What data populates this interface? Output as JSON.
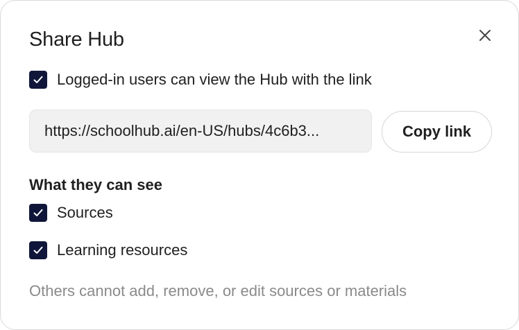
{
  "dialog": {
    "title": "Share Hub",
    "close_icon": "close-icon"
  },
  "access": {
    "logged_in_label": "Logged-in users can view the Hub with the link",
    "logged_in_checked": true
  },
  "link": {
    "value": "https://schoolhub.ai/en-US/hubs/4c6b3...",
    "copy_label": "Copy link"
  },
  "visibility": {
    "heading": "What they can see",
    "items": [
      {
        "label": "Sources",
        "checked": true
      },
      {
        "label": "Learning resources",
        "checked": true
      }
    ]
  },
  "note": "Others cannot add, remove, or edit sources or materials",
  "colors": {
    "checkbox": "#10163a",
    "text": "#1f1f1f",
    "muted": "#8a8a8a",
    "field_bg": "#f1f1f1"
  }
}
